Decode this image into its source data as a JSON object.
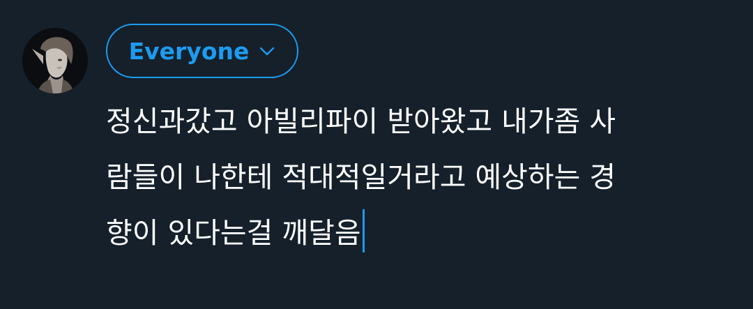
{
  "audience": {
    "label": "Everyone",
    "icon": "chevron-down-icon",
    "color": "#1d9bf0"
  },
  "avatar": {
    "icon": "avatar"
  },
  "tweet": {
    "lines": [
      "정신과갔고 아빌리파이 받아왔고 내가좀 사",
      "람들이 나한테 적대적일거라고 예상하는 경",
      "향이 있다는걸 깨달음"
    ]
  },
  "colors": {
    "background": "#15202b",
    "accent": "#1d9bf0",
    "text": "#ffffff"
  }
}
